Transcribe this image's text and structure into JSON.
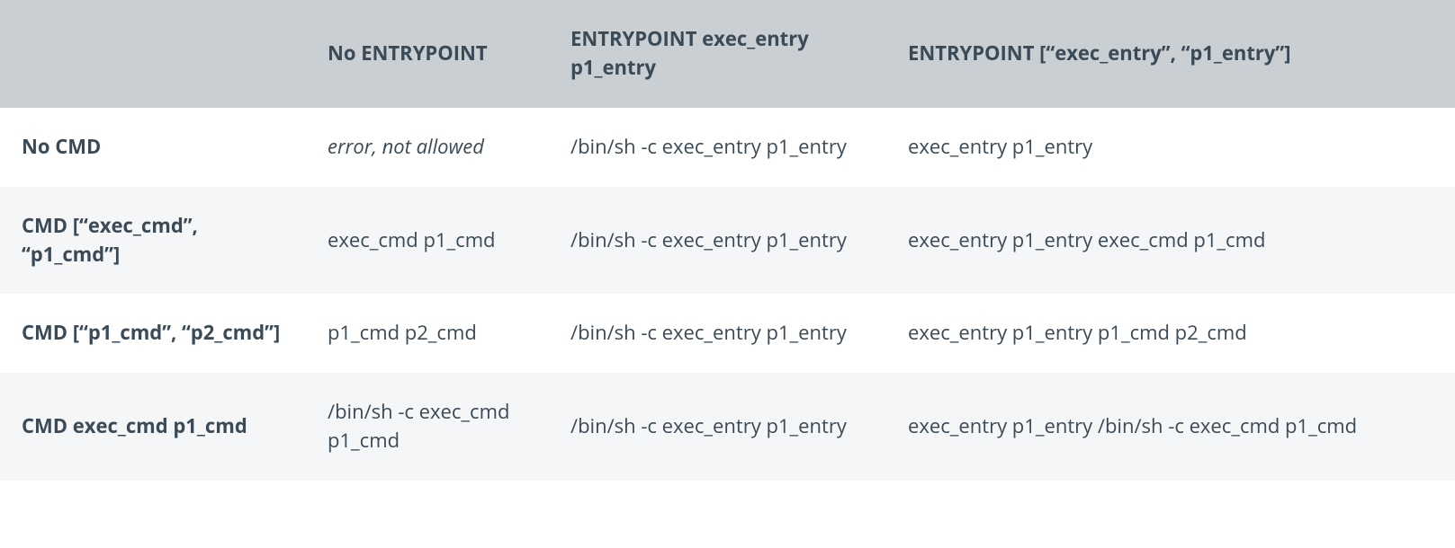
{
  "table": {
    "headers": [
      "",
      "No ENTRYPOINT",
      "ENTRYPOINT exec_entry p1_entry",
      "ENTRYPOINT [“exec_entry”, “p1_entry”]"
    ],
    "rows": [
      {
        "label": "No CMD",
        "cells": [
          {
            "text": "error, not allowed",
            "italic": true
          },
          {
            "text": "/bin/sh -c exec_entry p1_entry"
          },
          {
            "text": "exec_entry p1_entry"
          }
        ]
      },
      {
        "label": "CMD [“exec_cmd”, “p1_cmd”]",
        "cells": [
          {
            "text": "exec_cmd p1_cmd"
          },
          {
            "text": "/bin/sh -c exec_entry p1_entry"
          },
          {
            "text": "exec_entry p1_entry exec_cmd p1_cmd"
          }
        ]
      },
      {
        "label": "CMD [“p1_cmd”, “p2_cmd”]",
        "cells": [
          {
            "text": "p1_cmd p2_cmd"
          },
          {
            "text": "/bin/sh -c exec_entry p1_entry"
          },
          {
            "text": "exec_entry p1_entry p1_cmd p2_cmd"
          }
        ]
      },
      {
        "label": "CMD exec_cmd p1_cmd",
        "cells": [
          {
            "text": "/bin/sh -c exec_cmd p1_cmd"
          },
          {
            "text": "/bin/sh -c exec_entry p1_entry"
          },
          {
            "text": "exec_entry p1_entry /bin/sh -c exec_cmd p1_cmd"
          }
        ]
      }
    ]
  }
}
